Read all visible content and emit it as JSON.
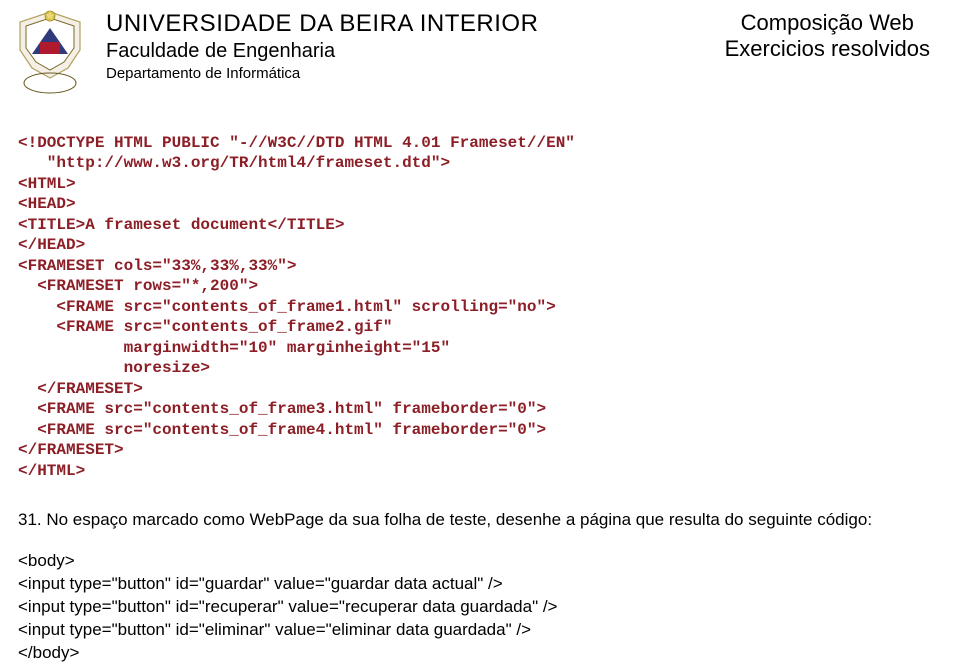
{
  "header": {
    "university": "UNIVERSIDADE DA BEIRA INTERIOR",
    "faculty": "Faculdade de Engenharia",
    "department": "Departamento de Informática",
    "right_line1": "Composição Web",
    "right_line2": "Exercicios resolvidos"
  },
  "code": {
    "l1": "<!DOCTYPE HTML PUBLIC \"-//W3C//DTD HTML 4.01 Frameset//EN\"",
    "l2": "   \"http://www.w3.org/TR/html4/frameset.dtd\">",
    "l3": "<HTML>",
    "l4": "<HEAD>",
    "l5": "<TITLE>A frameset document</TITLE>",
    "l6": "</HEAD>",
    "l7": "<FRAMESET cols=\"33%,33%,33%\">",
    "l8": "  <FRAMESET rows=\"*,200\">",
    "l9": "    <FRAME src=\"contents_of_frame1.html\" scrolling=\"no\">",
    "l10": "    <FRAME src=\"contents_of_frame2.gif\"",
    "l11": "           marginwidth=\"10\" marginheight=\"15\"",
    "l12": "           noresize>",
    "l13": "  </FRAMESET>",
    "l14": "  <FRAME src=\"contents_of_frame3.html\" frameborder=\"0\">",
    "l15": "  <FRAME src=\"contents_of_frame4.html\" frameborder=\"0\">",
    "l16": "</FRAMESET>",
    "l17": "</HTML>"
  },
  "question": "31. No espaço marcado como WebPage da sua folha de teste, desenhe a página que resulta do seguinte código:",
  "snippet": {
    "s1": "<body>",
    "s2": "<input type=\"button\" id=\"guardar\" value=\"guardar data actual\" />",
    "s3": "<input type=\"button\" id=\"recuperar\" value=\"recuperar data guardada\" />",
    "s4": "<input type=\"button\" id=\"eliminar\" value=\"eliminar data guardada\" />",
    "s5": "</body>"
  }
}
